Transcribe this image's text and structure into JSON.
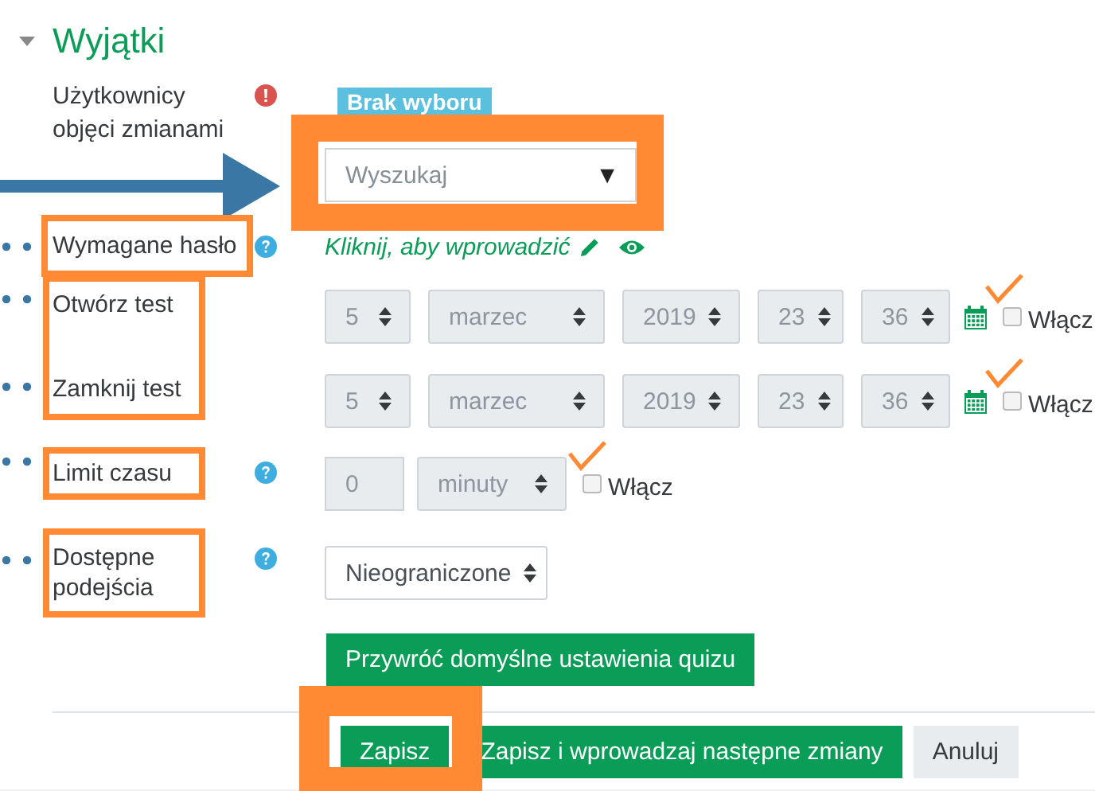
{
  "section": {
    "title": "Wyjątki",
    "expanded": true
  },
  "users": {
    "label": "Użytkownicy objęci zmianami",
    "badge": "Brak wyboru",
    "search": {
      "placeholder": "Wyszukaj",
      "arrow": "▼"
    }
  },
  "password": {
    "label": "Wymagane hasło",
    "link": "Kliknij, aby wprowadzić"
  },
  "dates": [
    {
      "label": "Otwórz test",
      "day": "5",
      "month": "marzec",
      "year": "2019",
      "hour": "23",
      "minute": "36",
      "enabled": false,
      "enable_label": "Włącz"
    },
    {
      "label": "Zamknij test",
      "day": "5",
      "month": "marzec",
      "year": "2019",
      "hour": "23",
      "minute": "36",
      "enabled": false,
      "enable_label": "Włącz"
    }
  ],
  "time_limit": {
    "label": "Limit czasu",
    "value": "0",
    "unit": "minuty",
    "enabled": false,
    "enable_label": "Włącz"
  },
  "attempts": {
    "label": "Dostępne podejścia",
    "value": "Nieograniczone"
  },
  "reset_button": "Przywróć domyślne ustawienia quizu",
  "buttons": [
    {
      "label": "Zapisz",
      "kind": "primary"
    },
    {
      "label": "Zapisz i wprowadzaj następne zmiany",
      "kind": "primary"
    },
    {
      "label": "Anuluj",
      "kind": "secondary"
    }
  ]
}
